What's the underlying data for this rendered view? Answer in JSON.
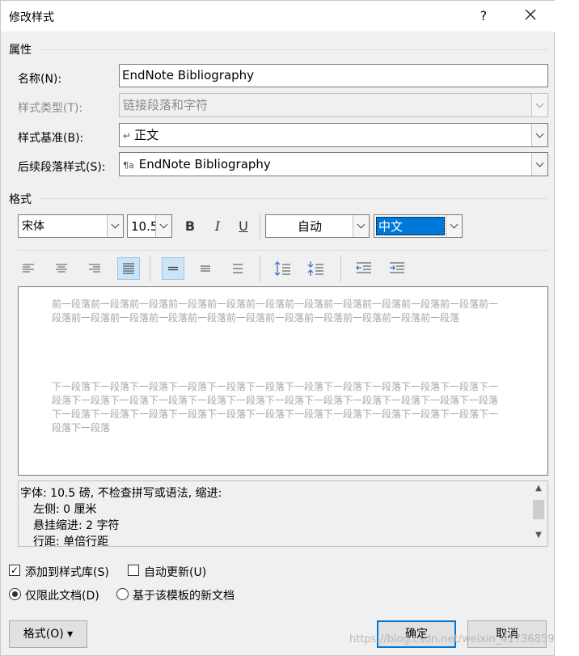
{
  "window": {
    "title": "修改样式",
    "help": "?",
    "close": "✕"
  },
  "properties": {
    "section": "属性",
    "name_label": "名称(N):",
    "name_value": "EndNote Bibliography",
    "type_label": "样式类型(T):",
    "type_value": "链接段落和字符",
    "based_label": "样式基准(B):",
    "based_value": "正文",
    "based_icon": "↵",
    "next_label": "后续段落样式(S):",
    "next_value": "EndNote Bibliography",
    "next_icon": "¶a"
  },
  "format": {
    "section": "格式",
    "font": "宋体",
    "size": "10.5",
    "bold": "B",
    "italic": "I",
    "underline": "U",
    "color": "自动",
    "script": "中文"
  },
  "preview": {
    "prev_para": "前一段落前一段落前一段落前一段落前一段落前一段落前一段落前一段落前一段落前一段落前一段落前一段落前一段落前一段落前一段落前一段落前一段落前一段落前一段落前一段落前一段落前一段落",
    "next_para": "下一段落下一段落下一段落下一段落下一段落下一段落下一段落下一段落下一段落下一段落下一段落下一段落下一段落下一段落下一段落下一段落下一段落下一段落下一段落下一段落下一段落下一段落下一段落下一段落下一段落下一段落下一段落下一段落下一段落下一段落下一段落下一段落下一段落下一段落下一段落下一段落"
  },
  "description": {
    "line1": "字体: 10.5 磅, 不检查拼写或语法, 缩进:",
    "line2": "左侧:  0 厘米",
    "line3": "悬挂缩进: 2 字符",
    "line4": "行距: 单倍行距"
  },
  "options": {
    "add_to_gallery": "添加到样式库(S)",
    "add_to_gallery_checked": true,
    "auto_update": "自动更新(U)",
    "auto_update_checked": false,
    "this_doc_only": "仅限此文档(D)",
    "new_docs": "基于该模板的新文档"
  },
  "buttons": {
    "format": "格式(O) ▾",
    "ok": "确定",
    "cancel": "取消"
  },
  "watermark": "https://blog.csdn.net/weixin_41736859"
}
